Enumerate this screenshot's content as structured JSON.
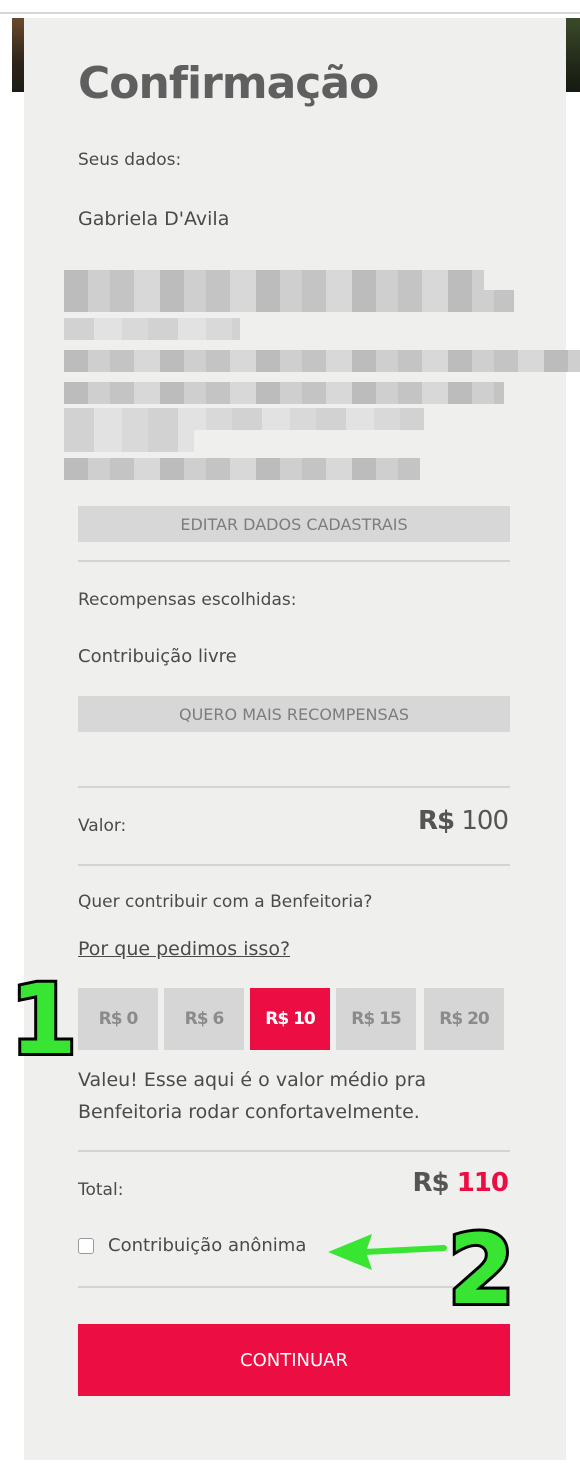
{
  "page": {
    "title": "Confirmação"
  },
  "user": {
    "section_label": "Seus dados:",
    "name": "Gabriela D'Avila",
    "edit_button": "EDITAR DADOS CADASTRAIS"
  },
  "rewards": {
    "section_label": "Recompensas escolhidas:",
    "chosen": "Contribuição livre",
    "more_button": "QUERO MAIS RECOMPENSAS"
  },
  "value": {
    "label": "Valor:",
    "currency": "R$",
    "amount": "100"
  },
  "contribution": {
    "question": "Quer contribuir com a Benfeitoria?",
    "why_link": "Por que pedimos isso?",
    "options": [
      "R$ 0",
      "R$ 6",
      "R$ 10",
      "R$ 15",
      "R$ 20"
    ],
    "selected": "R$ 10",
    "note": "Valeu! Esse aqui é o valor médio pra Benfeitoria rodar confortavelmente."
  },
  "total": {
    "label": "Total:",
    "currency": "R$",
    "amount": "110"
  },
  "anonymous": {
    "label": "Contribuição anônima",
    "checked": false
  },
  "continue_button": "CONTINUAR",
  "annotations": {
    "callout_1": "1",
    "callout_2": "2"
  },
  "colors": {
    "accent": "#ec0e43",
    "panel_bg": "#eff0ee",
    "button_gray": "#d7d7d7",
    "callout_green": "#39e533"
  }
}
